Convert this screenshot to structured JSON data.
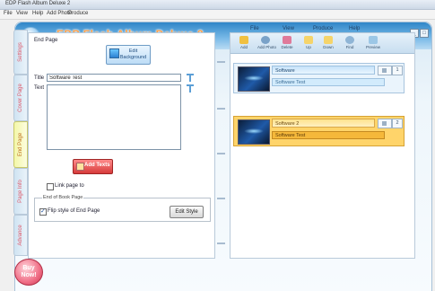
{
  "window": {
    "title": "EDP Flash Album Deluxe 2"
  },
  "menubar": {
    "items": [
      "File",
      "View",
      "Help",
      "Add Photo",
      "Produce"
    ]
  },
  "header": {
    "app_title": "EDP Flash Album Deluxe 2",
    "menu": [
      "File",
      "View",
      "Produce",
      "Help"
    ],
    "window_buttons": [
      "_",
      "□"
    ]
  },
  "left_tabs": [
    {
      "label": "Settings",
      "active": false
    },
    {
      "label": "Cover Page",
      "active": false
    },
    {
      "label": "End Page",
      "active": true
    },
    {
      "label": "Page Info",
      "active": false
    },
    {
      "label": "Advance",
      "active": false
    }
  ],
  "end_page": {
    "section_title": "End Page",
    "edit_background_label": "Edit Background",
    "title_label": "Title",
    "title_value": "Software Test",
    "text_label": "Text",
    "text_value": "",
    "add_text_label": "Add Texts",
    "link_label": "Link page to",
    "link_checked": false,
    "style_group_title": "End of Book Page",
    "flip_style_label": "Flip style of End Page",
    "flip_style_checked": true,
    "edit_style_label": "Edit Style"
  },
  "toolbar": {
    "buttons": [
      {
        "label": "Add",
        "icon": "add-page-icon"
      },
      {
        "label": "Add Photo",
        "icon": "add-photo-icon"
      },
      {
        "label": "Delete",
        "icon": "delete-icon"
      },
      {
        "label": "Up",
        "icon": "arrow-up-icon"
      },
      {
        "label": "Down",
        "icon": "arrow-down-icon"
      },
      {
        "label": "Find",
        "icon": "find-icon"
      },
      {
        "label": "Preview",
        "icon": "preview-icon"
      }
    ]
  },
  "pages": [
    {
      "name": "Software",
      "desc": "Software Test",
      "num": "1",
      "selected": false
    },
    {
      "name": "Software 2",
      "desc": "Software Test",
      "num": "2",
      "selected": true
    }
  ],
  "buy": {
    "line1": "Buy",
    "line2": "Now!"
  },
  "colors": {
    "header": "#2f86c8",
    "accent": "#ffa24d",
    "selected": "#ffd46a",
    "buy": "#f06e86"
  }
}
